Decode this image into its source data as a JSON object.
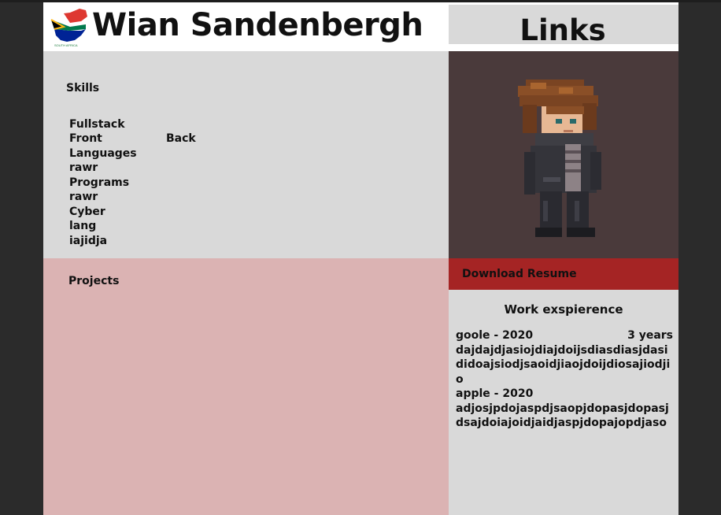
{
  "header": {
    "name": "Wian Sandenbergh",
    "logo_caption": "SOUTH AFRICA",
    "logo_icon": "south-africa-map-flag-icon"
  },
  "links": {
    "title": "Links"
  },
  "skills": {
    "heading": "Skills",
    "lines": [
      "Fullstack",
      "Front",
      "Languages",
      "rawr",
      "Programs",
      "rawr",
      "Cyber",
      "lang",
      "iajidja"
    ],
    "back_label": "Back"
  },
  "avatar": {
    "icon": "pixel-art-character-icon"
  },
  "projects": {
    "heading": "Projects"
  },
  "resume": {
    "label": "Download Resume"
  },
  "work": {
    "title": "Work exspierence",
    "jobs": [
      {
        "company_year": "goole - 2020",
        "duration": "3 years",
        "description": "dajdajdjasiojdiajdoijsdiasdiasjdasididoajsiodjsaoidjiaojdoijdiosajiodjio"
      },
      {
        "company_year": "apple - 2020",
        "duration": "",
        "description": "adjosjpdojaspdjsaopjdopasjdopasjdsajdoiajoidjaidjaspjdopajopdjaso"
      }
    ]
  },
  "colors": {
    "panel_gray": "#d9d9d9",
    "projects_pink": "#dbb3b3",
    "resume_red": "#a52424",
    "avatar_bg": "#4a3a3b",
    "page_bg": "#2b2b2b"
  }
}
